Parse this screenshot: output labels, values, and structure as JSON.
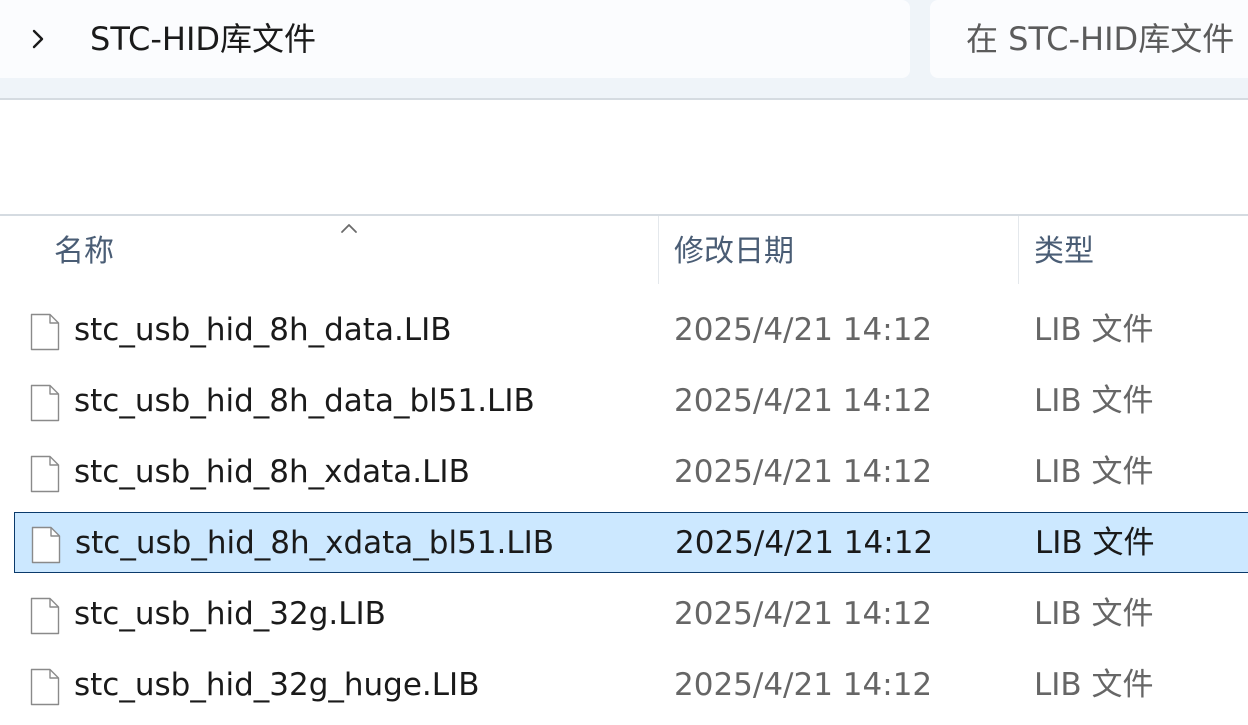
{
  "breadcrumb": {
    "current": "STC-HID库文件"
  },
  "search": {
    "placeholder": "在 STC-HID库文件"
  },
  "columns": {
    "name": "名称",
    "modified": "修改日期",
    "type": "类型"
  },
  "files": [
    {
      "name": "stc_usb_hid_8h_data.LIB",
      "modified": "2025/4/21 14:12",
      "type": "LIB 文件",
      "selected": false
    },
    {
      "name": "stc_usb_hid_8h_data_bl51.LIB",
      "modified": "2025/4/21 14:12",
      "type": "LIB 文件",
      "selected": false
    },
    {
      "name": "stc_usb_hid_8h_xdata.LIB",
      "modified": "2025/4/21 14:12",
      "type": "LIB 文件",
      "selected": false
    },
    {
      "name": "stc_usb_hid_8h_xdata_bl51.LIB",
      "modified": "2025/4/21 14:12",
      "type": "LIB 文件",
      "selected": true
    },
    {
      "name": "stc_usb_hid_32g.LIB",
      "modified": "2025/4/21 14:12",
      "type": "LIB 文件",
      "selected": false
    },
    {
      "name": "stc_usb_hid_32g_huge.LIB",
      "modified": "2025/4/21 14:12",
      "type": "LIB 文件",
      "selected": false
    }
  ],
  "icons": {
    "breadcrumb": "chevron-right-icon",
    "sort": "sort-ascending-icon",
    "file": "file-icon"
  },
  "colors": {
    "selection": "#cce8ff",
    "selection_border": "#0a3a6b",
    "header_text": "#4a5d75",
    "toolbar_bg": "#eff4f9"
  }
}
